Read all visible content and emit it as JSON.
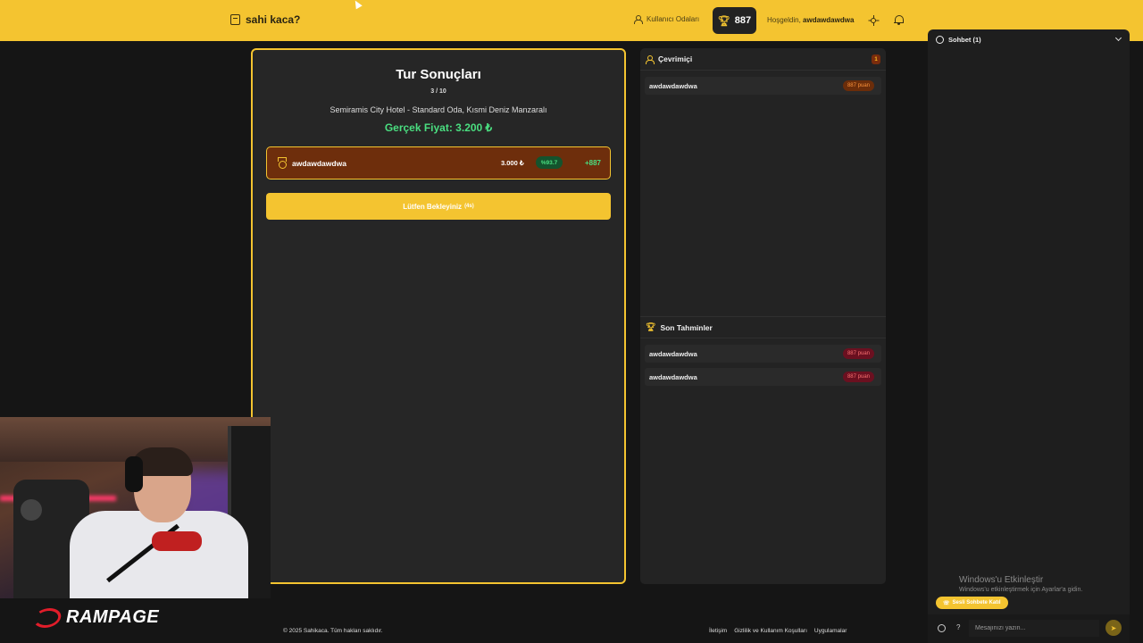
{
  "header": {
    "brand": "sahi kaca?",
    "rooms_link": "Kullanıcı Odaları",
    "score": "887",
    "welcome_prefix": "Hoşgeldin,",
    "username": "awdawdawdwa"
  },
  "result_card": {
    "title": "Tur Sonuçları",
    "round": "3 / 10",
    "item": "Semiramis City Hotel - Standard Oda, Kısmi Deniz Manzaralı",
    "real_price": "Gerçek Fiyat: 3.200 ₺",
    "results": [
      {
        "name": "awdawdawdwa",
        "guess": "3.000 ₺",
        "accuracy": "%93.7",
        "points": "+887"
      }
    ],
    "wait_label": "Lütfen Bekleyiniz",
    "wait_count": "(4s)"
  },
  "online": {
    "title": "Çevrimiçi",
    "count": "1",
    "users": [
      {
        "name": "awdawdawdwa",
        "points": "887 puan"
      }
    ]
  },
  "recent": {
    "title": "Son Tahminler",
    "items": [
      {
        "name": "awdawdawdwa",
        "points": "887 puan"
      },
      {
        "name": "awdawdawdwa",
        "points": "887 puan"
      }
    ]
  },
  "chat": {
    "title": "Sohbet (1)",
    "voice_button": "Sesli Sohbete Katıl",
    "input_placeholder": "Mesajınızı yazın...",
    "help": "?"
  },
  "windows": {
    "title": "Windows'u Etkinleştir",
    "subtitle": "Windows'u etkinleştirmek için Ayarlar'a gidin."
  },
  "footer": {
    "copyright": "© 2025 Sahikaca. Tüm hakları saklıdır.",
    "links": [
      "İletişim",
      "Gizlilik ve Kullanım Koşulları",
      "Uygulamalar"
    ]
  },
  "overlay": {
    "logo_text": "RAMPAGE"
  },
  "colors": {
    "accent": "#f4c430",
    "success": "#4ade80",
    "result_row": "#6e2e0c"
  }
}
